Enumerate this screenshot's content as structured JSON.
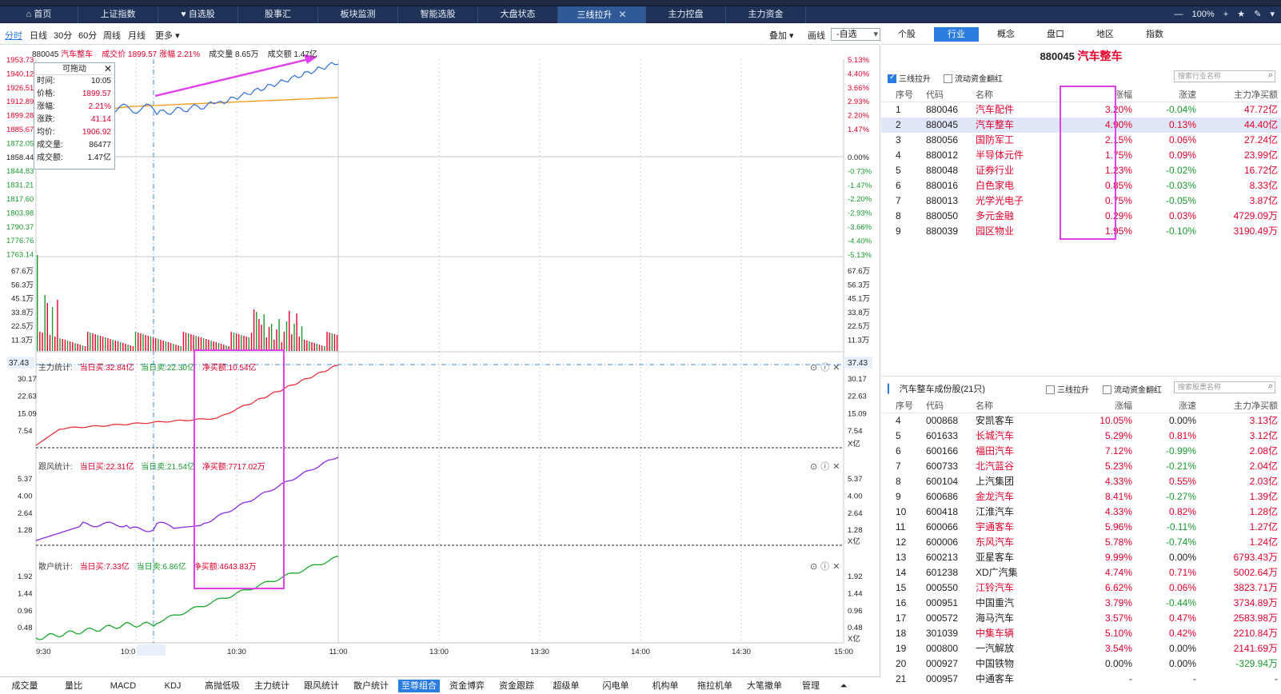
{
  "tabs": {
    "items": [
      {
        "label": "首页",
        "icon": "home-icon"
      },
      {
        "label": "上证指数"
      },
      {
        "label": "自选股",
        "icon": "heart-icon"
      },
      {
        "label": "股事汇"
      },
      {
        "label": "板块监测"
      },
      {
        "label": "智能选股"
      },
      {
        "label": "大盘状态"
      },
      {
        "label": "三线拉升",
        "active": true,
        "closable": true
      },
      {
        "label": "主力控盘"
      },
      {
        "label": "主力资金"
      }
    ],
    "zoom": "100%"
  },
  "toolbar": {
    "periods": [
      "分时",
      "日线",
      "30分",
      "60分",
      "周线",
      "月线",
      "更多"
    ],
    "active_period": "分时",
    "overlay_label": "叠加",
    "draw_label": "画线",
    "watch_select": "-自选"
  },
  "right_tabs": {
    "items": [
      "个股",
      "行业",
      "概念",
      "盘口",
      "地区",
      "指数"
    ],
    "active": "行业"
  },
  "stock": {
    "code": "880045",
    "name": "汽车整车",
    "price_label": "成交价 1899.57",
    "change_label": "涨幅 2.21%",
    "volume_label": "成交量 8.65万",
    "amount_label": "成交额 1.47亿"
  },
  "tooltip": {
    "title": "可拖动",
    "rows": [
      {
        "k": "时间:",
        "v": "10:05",
        "c": "#222"
      },
      {
        "k": "价格:",
        "v": "1899.57",
        "c": "#e4002b"
      },
      {
        "k": "涨幅:",
        "v": "2.21%",
        "c": "#e4002b"
      },
      {
        "k": "涨跌:",
        "v": "41.14",
        "c": "#e4002b"
      },
      {
        "k": "均价:",
        "v": "1906.92",
        "c": "#e4002b"
      },
      {
        "k": "成交量:",
        "v": "86477",
        "c": "#222"
      },
      {
        "k": "成交额:",
        "v": "1.47亿",
        "c": "#222"
      }
    ]
  },
  "price_axis": {
    "left": [
      "1953.73",
      "1940.12",
      "1926.51",
      "1912.89",
      "1899.28",
      "1885.67",
      "1872.05",
      "1858.44",
      "1844.83",
      "1831.21",
      "1817.60",
      "1803.98",
      "1790.37",
      "1776.76",
      "1763.14"
    ],
    "right": [
      "5.13%",
      "4.40%",
      "3.66%",
      "2.93%",
      "2.20%",
      "1.47%",
      "0.00%",
      "-0.73%",
      "-1.47%",
      "-2.20%",
      "-2.93%",
      "-3.66%",
      "-4.40%",
      "-5.13%"
    ]
  },
  "volume_axis": [
    "67.6万",
    "56.3万",
    "45.1万",
    "33.8万",
    "22.5万",
    "11.3万"
  ],
  "time_axis": [
    "9:30",
    "10:0",
    "10:05",
    "10:30",
    "11:00",
    "13:00",
    "13:30",
    "14:00",
    "14:30",
    "15:00"
  ],
  "panels": {
    "main": {
      "title": "主力统计:",
      "buy": "当日买:32.84亿",
      "sell": "当日卖:22.30亿",
      "net": "净买额:10.54亿",
      "axis": [
        "37.43",
        "30.17",
        "22.63",
        "15.09",
        "7.54"
      ],
      "unit": "X亿"
    },
    "follow": {
      "title": "跟风统计:",
      "buy": "当日买:22.31亿",
      "sell": "当日卖:21.54亿",
      "net": "净买额:7717.02万",
      "axis": [
        "5.37",
        "4.00",
        "2.64",
        "1.28"
      ],
      "unit": "X亿"
    },
    "retail": {
      "title": "散户统计:",
      "buy": "当日买:7.33亿",
      "sell": "当日卖:6.86亿",
      "net": "净买额:4643.83万",
      "axis": [
        "1.92",
        "1.44",
        "0.96",
        "0.48"
      ],
      "unit": "X亿"
    }
  },
  "bottom_tabs": {
    "items": [
      "成交量",
      "量比",
      "MACD",
      "KDJ",
      "高抛低吸",
      "主力统计",
      "跟风统计",
      "散户统计",
      "至尊组合",
      "资金博弈",
      "资金跟踪",
      "超级单",
      "闪电单",
      "机构单",
      "拖拉机单",
      "大笔撤单",
      "管理"
    ],
    "active": "至尊组合"
  },
  "industry_panel": {
    "title_code": "880045",
    "title_name": "汽车整车",
    "checkbox1": "三线拉升",
    "checkbox2": "流动资金翻红",
    "search_placeholder": "搜索行业名称",
    "headers": [
      "序号",
      "代码",
      "名称",
      "涨幅",
      "涨速",
      "主力净买额"
    ],
    "rows": [
      {
        "seq": "1",
        "code": "880046",
        "name": "汽车配件",
        "chg": "3.20%",
        "spd": "-0.04%",
        "net": "47.72亿"
      },
      {
        "seq": "2",
        "code": "880045",
        "name": "汽车整车",
        "chg": "4.90%",
        "spd": "0.13%",
        "net": "44.40亿",
        "selected": true
      },
      {
        "seq": "3",
        "code": "880056",
        "name": "国防军工",
        "chg": "2.15%",
        "spd": "0.06%",
        "net": "27.24亿"
      },
      {
        "seq": "4",
        "code": "880012",
        "name": "半导体元件",
        "chg": "1.75%",
        "spd": "0.09%",
        "net": "23.99亿"
      },
      {
        "seq": "5",
        "code": "880048",
        "name": "证券行业",
        "chg": "1.23%",
        "spd": "-0.02%",
        "net": "16.72亿"
      },
      {
        "seq": "6",
        "code": "880016",
        "name": "白色家电",
        "chg": "0.85%",
        "spd": "-0.03%",
        "net": "8.33亿"
      },
      {
        "seq": "7",
        "code": "880013",
        "name": "光学光电子",
        "chg": "0.75%",
        "spd": "-0.05%",
        "net": "3.87亿"
      },
      {
        "seq": "8",
        "code": "880050",
        "name": "多元金融",
        "chg": "0.29%",
        "spd": "0.03%",
        "net": "4729.09万"
      },
      {
        "seq": "9",
        "code": "880039",
        "name": "园区物业",
        "chg": "1.95%",
        "spd": "-0.10%",
        "net": "3190.49万"
      }
    ]
  },
  "component_panel": {
    "title": "汽车整车成份股(21只)",
    "checkbox1": "三线拉升",
    "checkbox2": "流动资金翻红",
    "search_placeholder": "搜索股票名称",
    "headers": [
      "序号",
      "代码",
      "名称",
      "涨幅",
      "涨速",
      "主力净买额"
    ],
    "rows": [
      {
        "seq": "4",
        "code": "000868",
        "name": "安凯客车",
        "chg": "10.05%",
        "spd": "0.00%",
        "net": "3.13亿"
      },
      {
        "seq": "5",
        "code": "601633",
        "name": "长城汽车",
        "chg": "5.29%",
        "spd": "0.81%",
        "net": "3.12亿"
      },
      {
        "seq": "6",
        "code": "600166",
        "name": "福田汽车",
        "chg": "7.12%",
        "spd": "-0.99%",
        "net": "2.08亿"
      },
      {
        "seq": "7",
        "code": "600733",
        "name": "北汽蓝谷",
        "chg": "5.23%",
        "spd": "-0.21%",
        "net": "2.04亿"
      },
      {
        "seq": "8",
        "code": "600104",
        "name": "上汽集团",
        "chg": "4.33%",
        "spd": "0.55%",
        "net": "2.03亿"
      },
      {
        "seq": "9",
        "code": "600686",
        "name": "金龙汽车",
        "chg": "8.41%",
        "spd": "-0.27%",
        "net": "1.39亿"
      },
      {
        "seq": "10",
        "code": "600418",
        "name": "江淮汽车",
        "chg": "4.33%",
        "spd": "0.82%",
        "net": "1.28亿"
      },
      {
        "seq": "11",
        "code": "600066",
        "name": "宇通客车",
        "chg": "5.96%",
        "spd": "-0.11%",
        "net": "1.27亿"
      },
      {
        "seq": "12",
        "code": "600006",
        "name": "东风汽车",
        "chg": "5.78%",
        "spd": "-0.74%",
        "net": "1.24亿"
      },
      {
        "seq": "13",
        "code": "600213",
        "name": "亚星客车",
        "chg": "9.99%",
        "spd": "0.00%",
        "net": "6793.43万"
      },
      {
        "seq": "14",
        "code": "601238",
        "name": "XD广汽集",
        "chg": "4.74%",
        "spd": "0.71%",
        "net": "5002.64万"
      },
      {
        "seq": "15",
        "code": "000550",
        "name": "江铃汽车",
        "chg": "6.62%",
        "spd": "0.06%",
        "net": "3823.71万"
      },
      {
        "seq": "16",
        "code": "000951",
        "name": "中国重汽",
        "chg": "3.79%",
        "spd": "-0.44%",
        "net": "3734.89万"
      },
      {
        "seq": "17",
        "code": "000572",
        "name": "海马汽车",
        "chg": "3.57%",
        "spd": "0.47%",
        "net": "2583.98万"
      },
      {
        "seq": "18",
        "code": "301039",
        "name": "中集车辆",
        "chg": "5.10%",
        "spd": "0.42%",
        "net": "2210.84万"
      },
      {
        "seq": "19",
        "code": "000800",
        "name": "一汽解放",
        "chg": "3.54%",
        "spd": "0.00%",
        "net": "2141.69万"
      },
      {
        "seq": "20",
        "code": "000927",
        "name": "中国铁物",
        "chg": "0.00%",
        "spd": "0.00%",
        "net": "-329.94万"
      },
      {
        "seq": "21",
        "code": "000957",
        "name": "中通客车",
        "chg": "-",
        "spd": "-",
        "net": "-"
      }
    ]
  },
  "colors": {
    "up": "#e4002b",
    "down": "#1a9b2f",
    "accent": "#2b7de0",
    "highlight": "#e040e8",
    "tabbar": "#1f3358"
  }
}
